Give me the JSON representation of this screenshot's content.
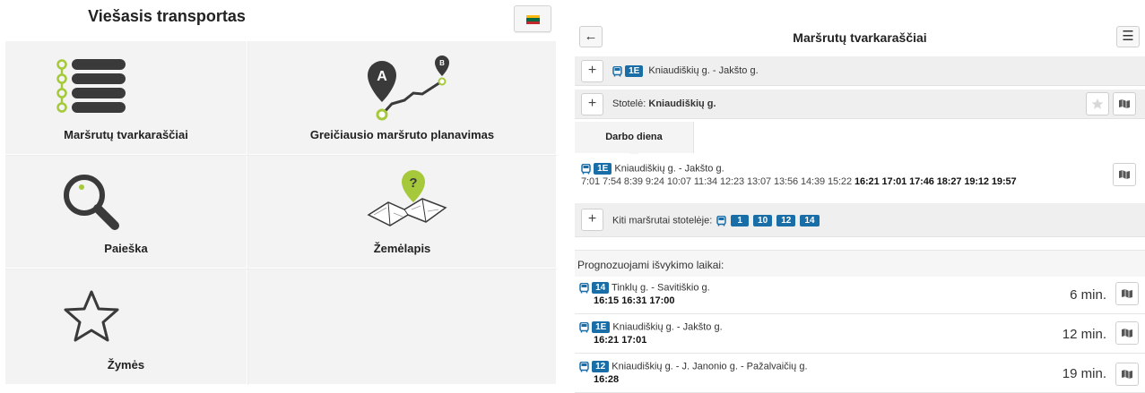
{
  "app": {
    "title": "Viešasis transportas",
    "flag_colors": [
      "#fdb913",
      "#006a44",
      "#c1272d"
    ]
  },
  "menu": {
    "schedules": "Maršrutų tvarkaraščiai",
    "route_planning": "Greičiausio maršruto planavimas",
    "search": "Paieška",
    "map": "Žemėlapis",
    "bookmarks": "Žymės"
  },
  "accent": {
    "green": "#a5c93a",
    "dark": "#3a3a3a",
    "blue": "#1a6ea8"
  },
  "schedule": {
    "title": "Maršrutų tvarkaraščiai",
    "back_icon": "arrow-left-icon",
    "menu_icon": "hamburger-icon",
    "selected_route": {
      "number": "1E",
      "name": "Kniaudiškių g. - Jakšto g."
    },
    "stop": {
      "label": "Stotelė:",
      "name": "Kniaudiškių g."
    },
    "tab": "Darbo diena",
    "route_times": {
      "number": "1E",
      "name": "Kniaudiškių g. - Jakšto g.",
      "past": "7:01 7:54 8:39 9:24 10:07 11:34 12:23 13:07 13:56 14:39 15:22",
      "upcoming": "16:21 17:01 17:46 18:27 19:12 19:57"
    },
    "other_routes_label": "Kiti maršrutai stotelėje:",
    "other_routes": [
      "1",
      "10",
      "12",
      "14"
    ],
    "predicted_title": "Prognozuojami išvykimo laikai:",
    "predictions": [
      {
        "number": "14",
        "name": "Tinklų g. - Savitiškio g.",
        "times": "16:15 16:31 17:00",
        "eta": "6 min."
      },
      {
        "number": "1E",
        "name": "Kniaudiškių g. - Jakšto g.",
        "times": "16:21 17:01",
        "eta": "12 min."
      },
      {
        "number": "12",
        "name": "Kniaudiškių g. - J. Janonio g. - Pažalvaičių g.",
        "times": "16:28",
        "eta": "19 min."
      }
    ]
  }
}
